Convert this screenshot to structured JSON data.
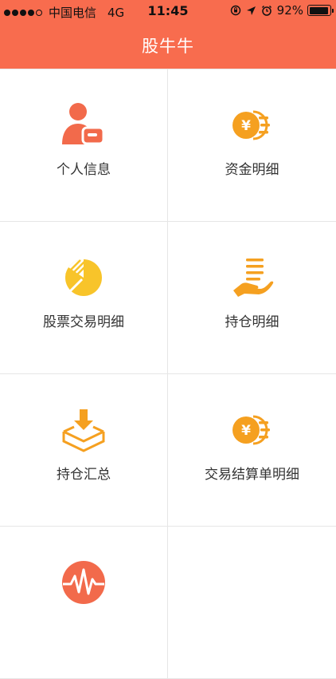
{
  "status_bar": {
    "carrier": "中国电信",
    "network": "4G",
    "time": "11:45",
    "battery": "92%",
    "battery_level": 0.92
  },
  "nav": {
    "title": "股牛牛"
  },
  "menu": {
    "items": [
      {
        "label": "个人信息",
        "icon": "user-card-icon"
      },
      {
        "label": "资金明细",
        "icon": "yen-coin-icon"
      },
      {
        "label": "股票交易明细",
        "icon": "pie-chart-icon"
      },
      {
        "label": "持仓明细",
        "icon": "hand-document-icon"
      },
      {
        "label": "持仓汇总",
        "icon": "download-tray-icon"
      },
      {
        "label": "交易结算单明细",
        "icon": "yen-coin-icon"
      },
      {
        "label": "",
        "icon": "pulse-icon"
      }
    ]
  },
  "colors": {
    "header": "#f86c4e",
    "icon_orange": "#f5a020",
    "icon_red": "#f26a4b",
    "icon_yellow": "#f8c42a"
  }
}
